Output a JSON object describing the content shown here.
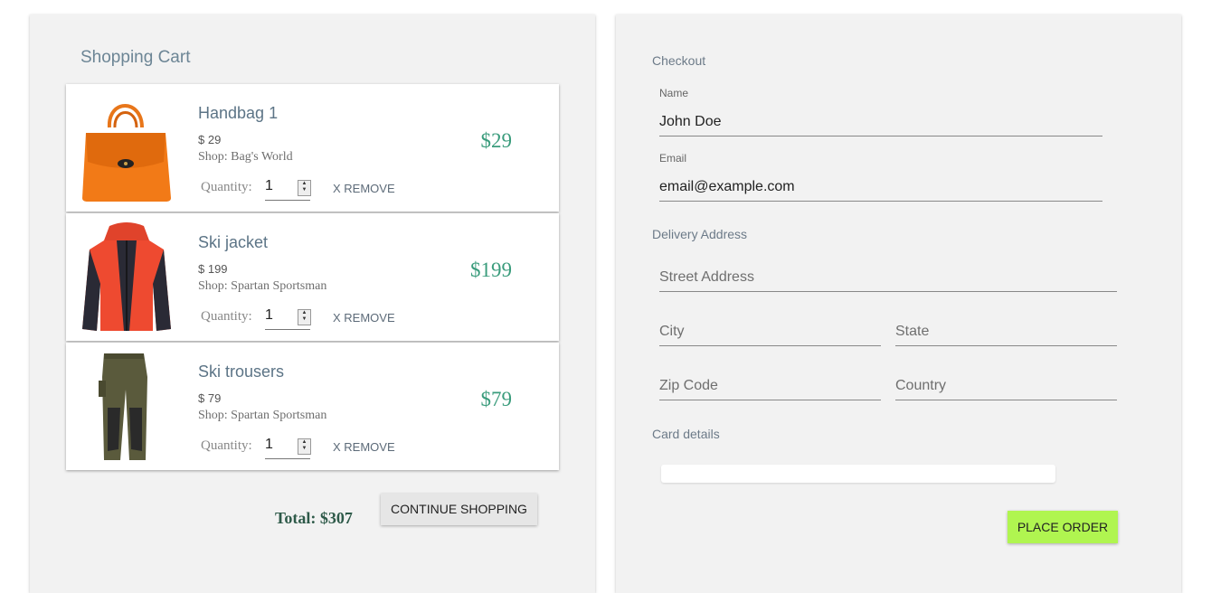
{
  "cart": {
    "title": "Shopping Cart",
    "items": [
      {
        "name": "Handbag 1",
        "price": "$ 29",
        "shop": "Shop: Bag's World",
        "quantity_label": "Quantity:",
        "quantity": "1",
        "remove_label": "X REMOVE",
        "total": "$29"
      },
      {
        "name": "Ski jacket",
        "price": "$ 199",
        "shop": "Shop: Spartan Sportsman",
        "quantity_label": "Quantity:",
        "quantity": "1",
        "remove_label": "X REMOVE",
        "total": "$199"
      },
      {
        "name": "Ski trousers",
        "price": "$ 79",
        "shop": "Shop: Spartan Sportsman",
        "quantity_label": "Quantity:",
        "quantity": "1",
        "remove_label": "X REMOVE",
        "total": "$79"
      }
    ],
    "total": "Total: $307",
    "continue_label": "CONTINUE SHOPPING"
  },
  "checkout": {
    "title": "Checkout",
    "name_label": "Name",
    "name_value": "John Doe",
    "email_label": "Email",
    "email_value": "email@example.com",
    "delivery_title": "Delivery Address",
    "street_placeholder": "Street Address",
    "city_placeholder": "City",
    "state_placeholder": "State",
    "zip_placeholder": "Zip Code",
    "country_placeholder": "Country",
    "card_title": "Card details",
    "place_order_label": "PLACE ORDER"
  },
  "colors": {
    "accent_price": "#3a9c7c",
    "place_order_bg": "#b0f550",
    "panel_bg": "#f2f2f2"
  }
}
